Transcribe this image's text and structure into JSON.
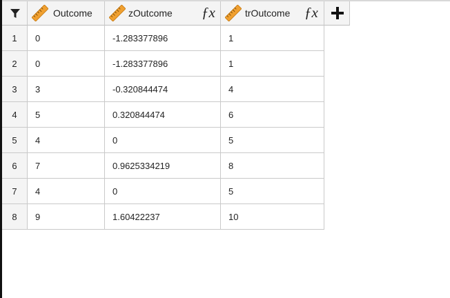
{
  "toolbar": {
    "filter_icon": "filter-icon",
    "add_column_icon": "plus-icon"
  },
  "columns": [
    {
      "label": "Outcome",
      "icon": "ruler-icon",
      "computed": false
    },
    {
      "label": "zOutcome",
      "icon": "ruler-icon",
      "computed": true,
      "formula_icon": "fx-icon"
    },
    {
      "label": "trOutcome",
      "icon": "ruler-icon",
      "computed": true,
      "formula_icon": "fx-icon"
    }
  ],
  "rows": [
    {
      "n": "1",
      "outcome": "0",
      "z": "-1.283377896",
      "tr": "1"
    },
    {
      "n": "2",
      "outcome": "0",
      "z": "-1.283377896",
      "tr": "1"
    },
    {
      "n": "3",
      "outcome": "3",
      "z": "-0.320844474",
      "tr": "4"
    },
    {
      "n": "4",
      "outcome": "5",
      "z": "0.320844474",
      "tr": "6"
    },
    {
      "n": "5",
      "outcome": "4",
      "z": "0",
      "tr": "5"
    },
    {
      "n": "6",
      "outcome": "7",
      "z": "0.9625334219",
      "tr": "8"
    },
    {
      "n": "7",
      "outcome": "4",
      "z": "0",
      "tr": "5"
    },
    {
      "n": "8",
      "outcome": "9",
      "z": "1.60422237",
      "tr": "10"
    }
  ],
  "colors": {
    "ruler_orange": "#f0a030",
    "header_bg": "#f4f4f4",
    "grid_line": "#c9c9c9"
  }
}
